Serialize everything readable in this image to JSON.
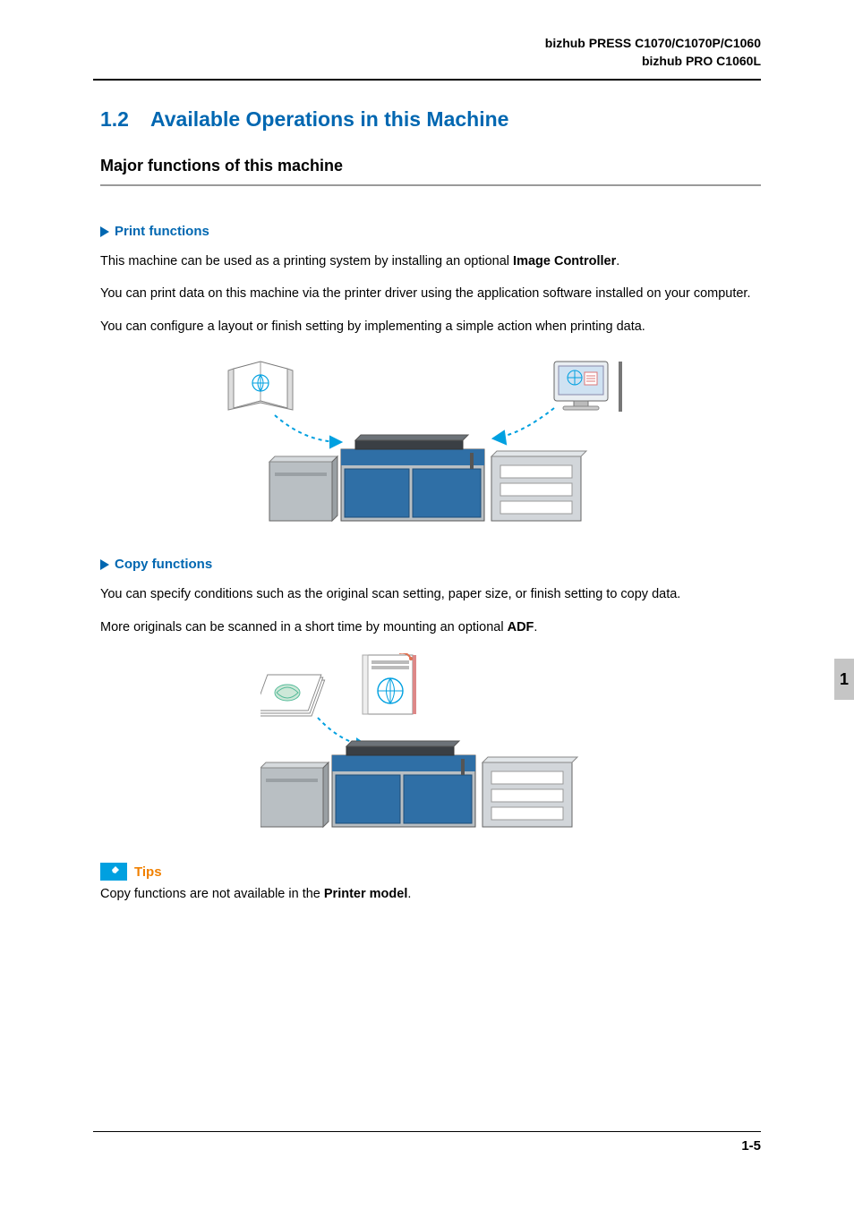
{
  "header": {
    "line1": "bizhub PRESS C1070/C1070P/C1060",
    "line2": "bizhub PRO C1060L"
  },
  "section": {
    "number": "1.2",
    "title": "Available Operations in this Machine"
  },
  "subtitle": "Major functions of this machine",
  "print": {
    "heading": "Print functions",
    "p1a": "This machine can be used as a printing system by installing an optional ",
    "p1b": "Image Controller",
    "p1c": ".",
    "p2": "You can print data on this machine via the printer driver using the application software installed on your computer.",
    "p3": "You can configure a layout or finish setting by implementing a simple action when printing data."
  },
  "copy": {
    "heading": "Copy functions",
    "p1": "You can specify conditions such as the original scan setting, paper size, or finish setting to copy data.",
    "p2a": "More originals can be scanned in a short time by mounting an optional ",
    "p2b": "ADF",
    "p2c": "."
  },
  "tips": {
    "label": "Tips",
    "text_a": "Copy functions are not available in the ",
    "text_b": "Printer model",
    "text_c": "."
  },
  "side_tab": "1",
  "page_number": "1-5"
}
